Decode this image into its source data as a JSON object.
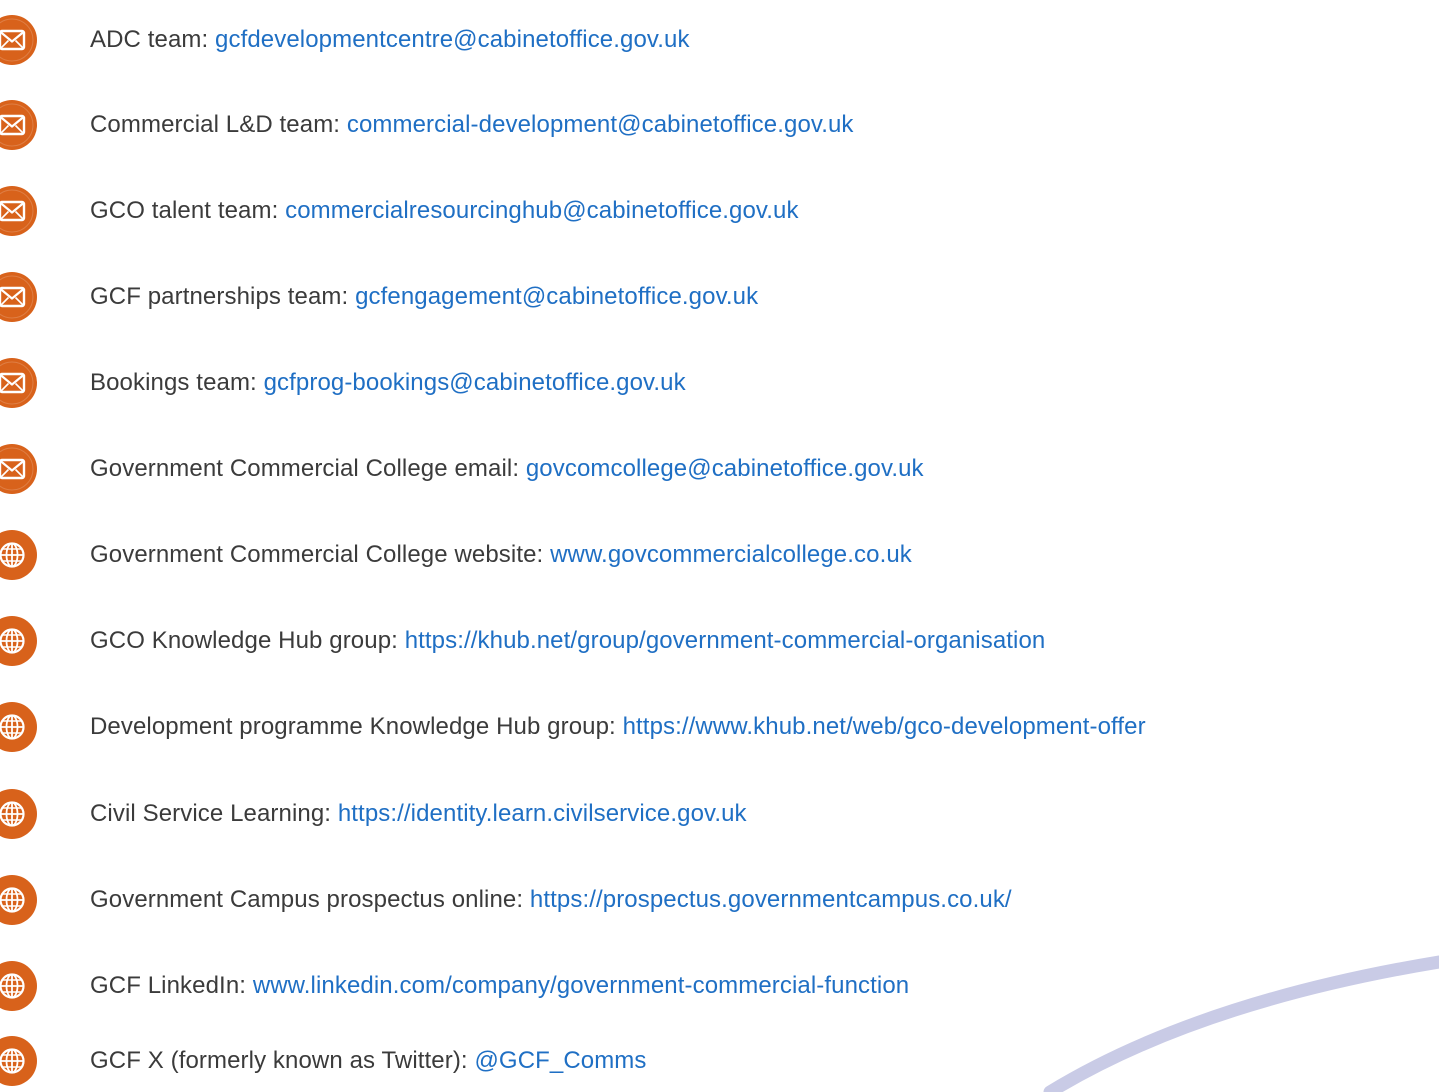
{
  "colors": {
    "icon_orange": "#d8621b",
    "link_blue": "#1f6fc4",
    "text_gray": "#3b3b3b",
    "arc_lavender": "#c9cbe6"
  },
  "contacts": [
    {
      "icon": "envelope-icon",
      "label": "ADC team: ",
      "link": "gcfdevelopmentcentre@cabinetoffice.gov.uk"
    },
    {
      "icon": "envelope-icon",
      "label": "Commercial L&D team: ",
      "link": "commercial-development@cabinetoffice.gov.uk"
    },
    {
      "icon": "envelope-icon",
      "label": "GCO talent team: ",
      "link": "commercialresourcinghub@cabinetoffice.gov.uk"
    },
    {
      "icon": "envelope-icon",
      "label": "GCF partnerships team: ",
      "link": "gcfengagement@cabinetoffice.gov.uk"
    },
    {
      "icon": "envelope-icon",
      "label": "Bookings team: ",
      "link": "gcfprog-bookings@cabinetoffice.gov.uk"
    },
    {
      "icon": "envelope-icon",
      "label": "Government Commercial College email: ",
      "link": "govcomcollege@cabinetoffice.gov.uk"
    },
    {
      "icon": "globe-icon",
      "label": "Government Commercial College website: ",
      "link": "www.govcommercialcollege.co.uk"
    },
    {
      "icon": "globe-icon",
      "label": "GCO Knowledge Hub group: ",
      "link": "https://khub.net/group/government-commercial-organisation"
    },
    {
      "icon": "globe-icon",
      "label": "Development programme Knowledge Hub group: ",
      "link": "https://www.khub.net/web/gco-development-offer"
    },
    {
      "icon": "globe-icon",
      "label": "Civil Service Learning: ",
      "link": "https://identity.learn.civilservice.gov.uk"
    },
    {
      "icon": "globe-icon",
      "label": "Government Campus prospectus online: ",
      "link": "https://prospectus.governmentcampus.co.uk/"
    },
    {
      "icon": "globe-icon",
      "label": "GCF LinkedIn: ",
      "link": "www.linkedin.com/company/government-commercial-function"
    },
    {
      "icon": "globe-icon",
      "label": "GCF X (formerly known as Twitter): ",
      "link": "@GCF_Comms"
    }
  ]
}
